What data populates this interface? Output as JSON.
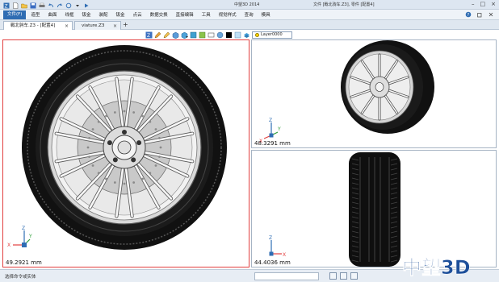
{
  "titlebar": {
    "app_title": "中望3D 2014",
    "doc_title": "文件 [戰北驹车.Z3], 零件 [配置4]",
    "qat_icons": [
      "app-logo-icon",
      "new-file-icon",
      "open-file-icon",
      "save-icon",
      "print-icon",
      "undo-icon",
      "redo-icon",
      "refresh-icon",
      "dropdown-icon",
      "run-icon"
    ],
    "window_controls": [
      "minimize-icon",
      "restore-icon",
      "close-icon"
    ]
  },
  "menubar": {
    "file_tab": "文件(F)",
    "items": [
      "造型",
      "曲面",
      "线框",
      "钣金",
      "装配",
      "钣金",
      "点云",
      "数据交换",
      "直接编辑",
      "工具",
      "视觉样式",
      "查询",
      "模具"
    ]
  },
  "tabs": [
    {
      "label": "戰北驹车.Z3 - [配置4]",
      "active": true
    },
    {
      "label": "viature.Z3",
      "active": false
    }
  ],
  "view_toolbar": {
    "icons": [
      "fit-view-icon",
      "pen-icon",
      "pencil-icon",
      "box-icon",
      "view-cube-icon",
      "display-mode-icon",
      "filter-icon",
      "section-icon",
      "shading-icon",
      "color-black-icon",
      "color-light-icon",
      "layer-icon"
    ],
    "layer_value": "Layer0000"
  },
  "viewports": {
    "main": {
      "scale": "49.2921 mm",
      "axis_labels": [
        "Z",
        "Y",
        "X"
      ]
    },
    "top_right": {
      "scale": "48.3291 mm",
      "axis_labels": [
        "Z",
        "Y",
        "X"
      ]
    },
    "bottom_right": {
      "scale": "44.4036 mm",
      "axis_labels": [
        "Z",
        "X"
      ]
    }
  },
  "statusbar": {
    "text": "选择命令或实体"
  },
  "colors": {
    "accent": "#2f6db3",
    "active_viewport_border": "#e24040"
  },
  "watermark": "中望3D"
}
